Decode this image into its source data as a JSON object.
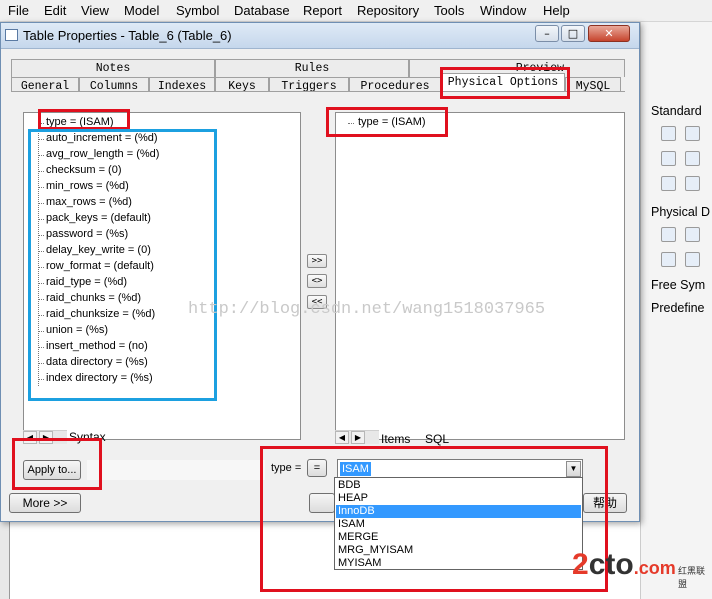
{
  "menubar": {
    "items": [
      "File",
      "Edit",
      "View",
      "Model",
      "Symbol",
      "Database",
      "Report",
      "Repository",
      "Tools",
      "Window",
      "Help"
    ]
  },
  "dialog": {
    "title": "Table Properties - Table_6 (Table_6)",
    "tabs_back": [
      "Notes",
      "Rules",
      "Preview"
    ],
    "tabs_front": [
      "General",
      "Columns",
      "Indexes",
      "Keys",
      "Triggers",
      "Procedures",
      "Physical Options",
      "MySQL"
    ],
    "active_tab": "Physical Options",
    "available_options": [
      "type = (ISAM)",
      "auto_increment = (%d)",
      "avg_row_length = (%d)",
      "checksum = (0)",
      "min_rows = (%d)",
      "max_rows = (%d)",
      "pack_keys = (default)",
      "password = (%s)",
      "delay_key_write = (0)",
      "row_format = (default)",
      "raid_type = (%d)",
      "raid_chunks = (%d)",
      "raid_chunksize = (%d)",
      "union = (%s)",
      "insert_method = (no)",
      "data directory = (%s)",
      "index directory = (%s)"
    ],
    "selected_options": [
      "type = (ISAM)"
    ],
    "move_buttons": [
      ">>",
      "<>",
      "<<"
    ],
    "left_subtab": "Syntax",
    "right_subtabs": [
      "Items",
      "SQL"
    ],
    "apply_button": "Apply to...",
    "more_button": "More >>",
    "type_label": "type =",
    "eq_label": "=",
    "type_value": "ISAM",
    "type_options": [
      "BDB",
      "HEAP",
      "InnoDB",
      "ISAM",
      "MERGE",
      "MRG_MYISAM",
      "MYISAM"
    ],
    "selected_type": "InnoDB",
    "help_fragment": "帮助"
  },
  "right_panel": {
    "items": [
      "Standard",
      "Physical D",
      "Free Sym",
      "Predefine"
    ]
  },
  "watermark": "http://blog.csdn.net/wang1518037965",
  "logo": {
    "part1": "2",
    "part2": "cto",
    "part3": ".com",
    "cn": "红黑联盟"
  },
  "colors": {
    "annotation_red": "#e0101e",
    "annotation_blue": "#1ca0e0",
    "selection": "#3399ff"
  }
}
